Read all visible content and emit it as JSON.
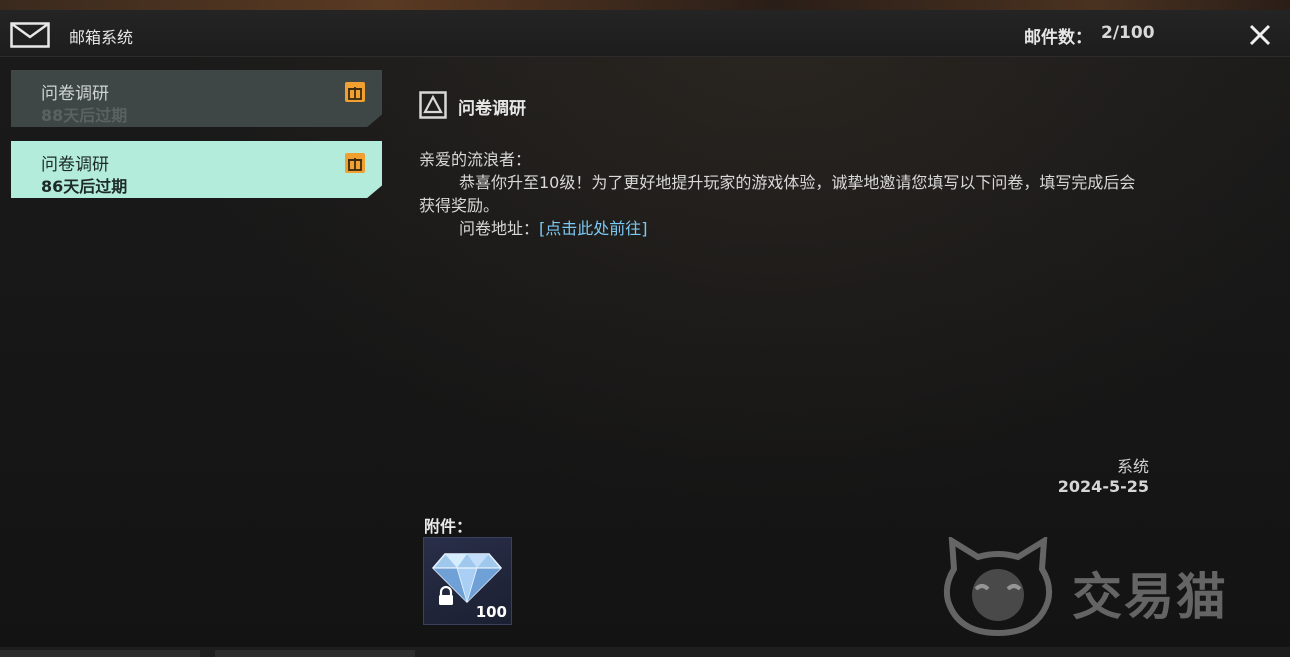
{
  "header": {
    "title": "邮箱系统",
    "count_label": "邮件数：",
    "count_value": "2/100"
  },
  "mail_list": [
    {
      "title": "问卷调研",
      "expiry": "88天后过期",
      "state": "read"
    },
    {
      "title": "问卷调研",
      "expiry": "86天后过期",
      "state": "selected"
    }
  ],
  "mail": {
    "subject": "问卷调研",
    "greeting": "亲爱的流浪者：",
    "line1": "恭喜你升至10级！为了更好地提升玩家的游戏体验，诚挚地邀请您填写以下问卷，填写完成后会",
    "line2": "获得奖励。",
    "link_prefix": "问卷地址：",
    "link_text": "[点击此处前往]",
    "sender": "系统",
    "date": "2024-5-25",
    "attachment_label": "附件：",
    "attachments": [
      {
        "icon": "diamond-icon",
        "quantity": "100",
        "locked": true
      }
    ]
  },
  "watermark": {
    "text": "交易猫"
  },
  "colors": {
    "selected_item": "#b4ecdc",
    "read_item": "#3f4746",
    "link": "#7cc8f4",
    "gift_icon": "#f0a030"
  }
}
